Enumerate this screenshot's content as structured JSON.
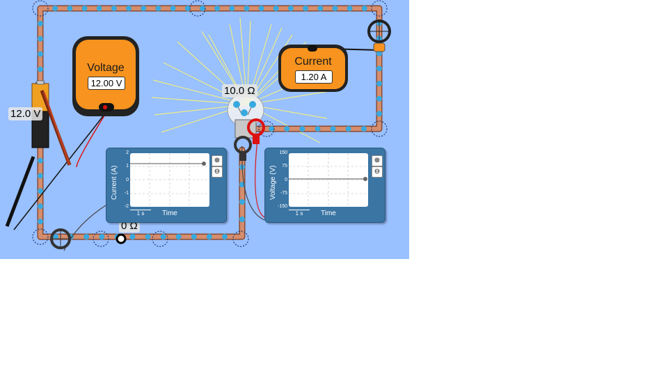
{
  "voltmeter": {
    "title": "Voltage",
    "reading": "12.00 V"
  },
  "ammeter": {
    "title": "Current",
    "reading": "1.20 A"
  },
  "battery": {
    "label": "12.0 V"
  },
  "bulb": {
    "label": "10.0 Ω"
  },
  "switch": {
    "label": "0 Ω"
  },
  "current_chart": {
    "ylabel": "Current (A)",
    "ticks": [
      "2",
      "1",
      "0",
      "-1",
      "-2"
    ],
    "xlabel": "Time",
    "scale": "1 s",
    "zoom_in": "⊕",
    "zoom_out": "⊖"
  },
  "voltage_chart": {
    "ylabel": "Voltage (V)",
    "ticks": [
      "150",
      "75",
      "0",
      "-75",
      "-150"
    ],
    "xlabel": "Time",
    "scale": "1 s",
    "zoom_in": "⊕",
    "zoom_out": "⊖"
  },
  "colors": {
    "background": "#99c0ff",
    "wire": "#c97c5d",
    "electron": "#38a9e0",
    "meter_body": "#f7931e",
    "chart_panel": "#3a75a4"
  }
}
